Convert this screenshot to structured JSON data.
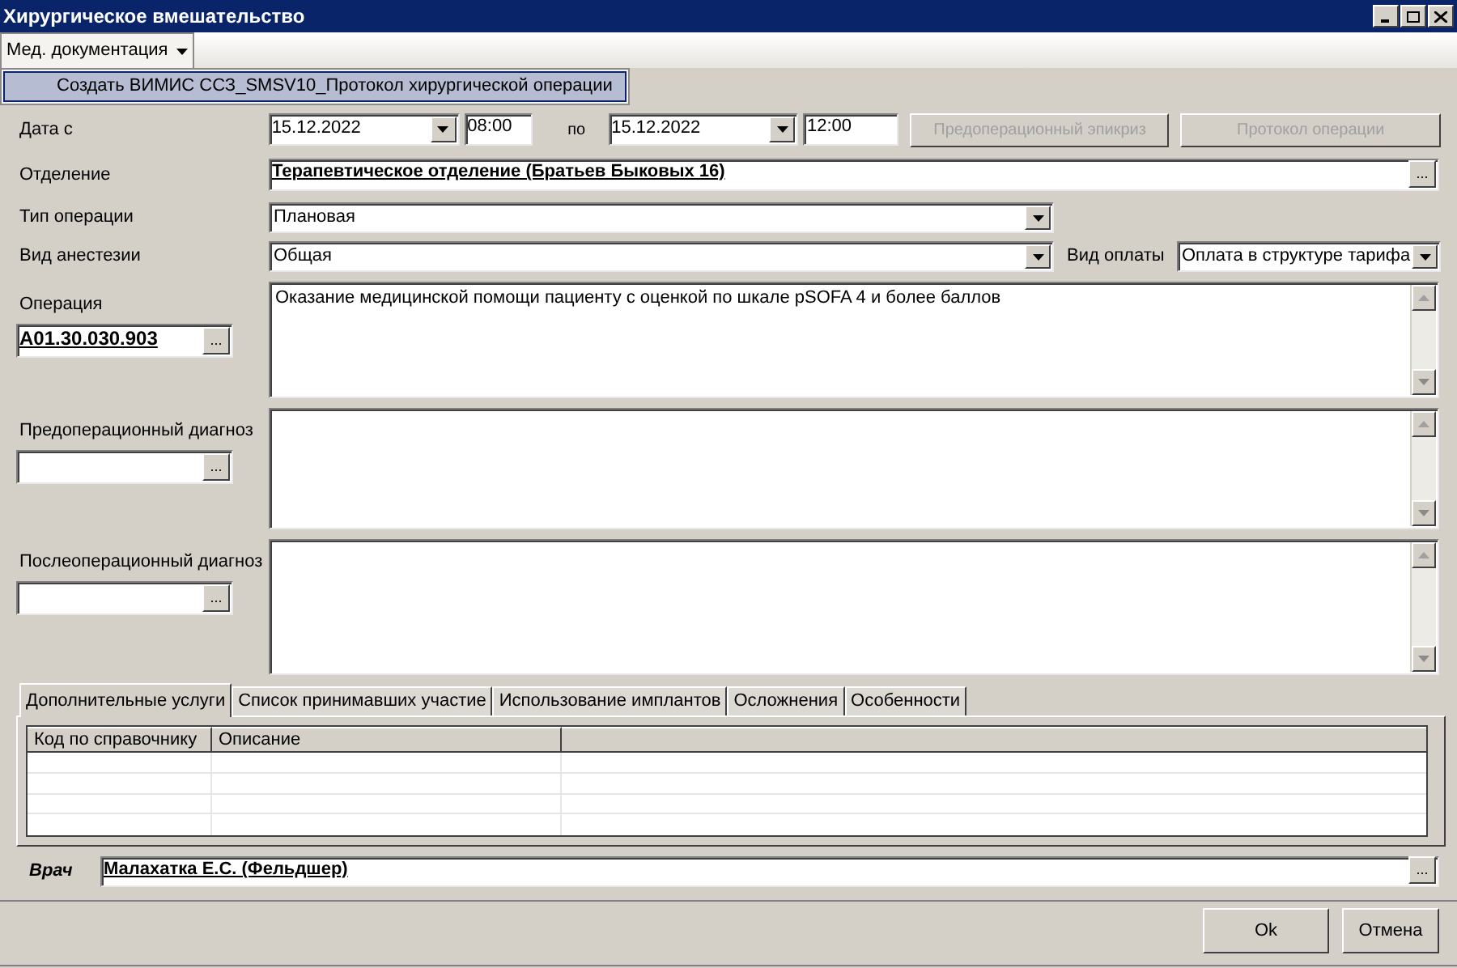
{
  "window": {
    "title": "Хирургическое вмешательство"
  },
  "menu": {
    "label": "Мед. документация",
    "expanded": true,
    "items": [
      {
        "label": "Создать ВИМИС ССЗ_SMSV10_Протокол хирургической операции",
        "selected": true
      }
    ]
  },
  "date_row": {
    "label": "Дата с",
    "date_from": "15.12.2022",
    "time_from": "08:00",
    "to_label": "по",
    "date_to": "15.12.2022",
    "time_to": "12:00",
    "buttons": [
      {
        "label": "Предоперационный эпикриз",
        "disabled": true
      },
      {
        "label": "Протокол операции",
        "disabled": true
      }
    ]
  },
  "department": {
    "label": "Отделение",
    "value": "Терапевтическое отделение (Братьев Быковых 16)",
    "button": "..."
  },
  "operation_type": {
    "label": "Тип операции",
    "value": "Плановая"
  },
  "anesthesia": {
    "label": "Вид анестезии",
    "value": "Общая"
  },
  "payment": {
    "label": "Вид оплаты",
    "value": "Оплата в структуре тарифа"
  },
  "code_blocks": [
    {
      "label": "Операция",
      "code": "A01.30.030.903",
      "button": "...",
      "text": "Оказание медицинской помощи пациенту с оценкой по шкале pSOFA 4 и более баллов"
    },
    {
      "label": "Предоперационный диагноз",
      "button": "..."
    },
    {
      "label": "Послеоперационный диагноз",
      "button": "..."
    }
  ],
  "tabs": [
    {
      "label": "Дополнительные услуги",
      "selected": true
    },
    {
      "label": "Список принимавших участие",
      "selected": false
    },
    {
      "label": "Использование имплантов",
      "selected": false
    },
    {
      "label": "Осложнения",
      "selected": false
    },
    {
      "label": "Особенности",
      "selected": false
    }
  ],
  "table": {
    "columns": [
      "Код по справочнику",
      "Описание"
    ]
  },
  "doctor": {
    "label": "Врач",
    "value": "Малахатка Е.С. (Фельдшер)",
    "button": "..."
  },
  "buttons": [
    {
      "label": "Ok"
    },
    {
      "label": "Отмена"
    }
  ]
}
